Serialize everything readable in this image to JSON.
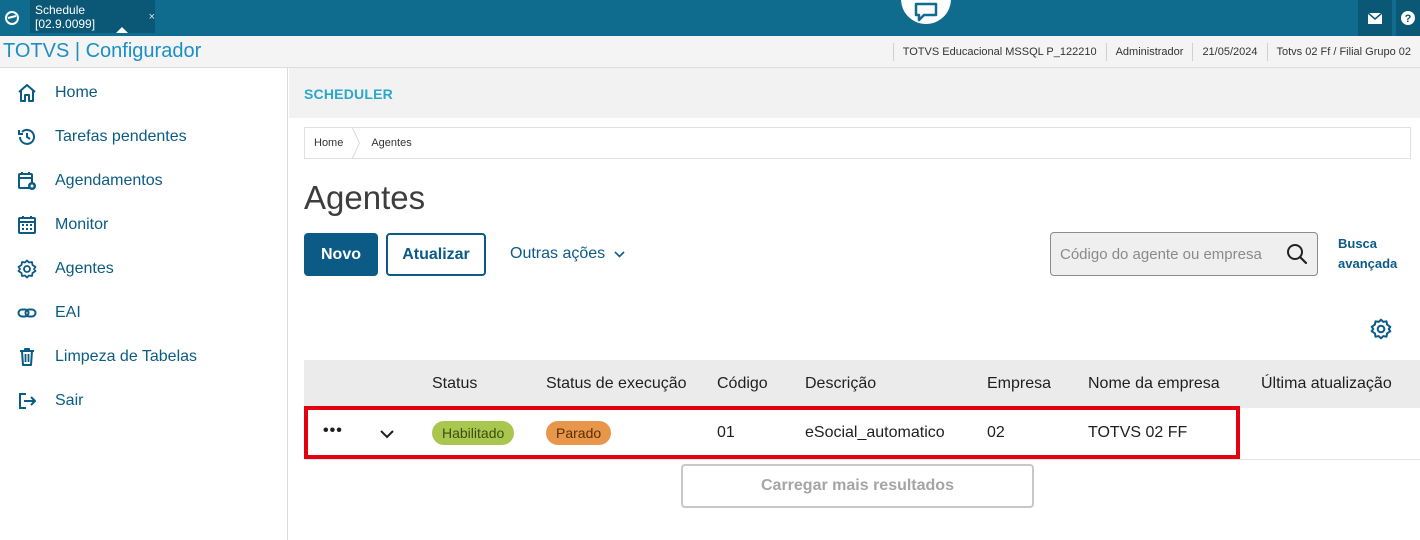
{
  "topbar": {
    "tab_title": "Schedule [02.9.0099]",
    "tab_close": "×",
    "colors": {
      "bar": "#0f6c8f",
      "tab": "#0a5875"
    }
  },
  "header": {
    "app_title": "TOTVS | Configurador",
    "database": "TOTVS Educacional MSSQL P_122210",
    "user": "Administrador",
    "date": "21/05/2024",
    "company": "Totvs 02 Ff / Filial Grupo 02"
  },
  "sidebar": {
    "items": [
      {
        "label": "Home",
        "icon": "home-icon"
      },
      {
        "label": "Tarefas pendentes",
        "icon": "history-icon"
      },
      {
        "label": "Agendamentos",
        "icon": "calendar-gear-icon"
      },
      {
        "label": "Monitor",
        "icon": "calendar-icon"
      },
      {
        "label": "Agentes",
        "icon": "gear-icon"
      },
      {
        "label": "EAI",
        "icon": "link-icon"
      },
      {
        "label": "Limpeza de Tabelas",
        "icon": "trash-icon"
      },
      {
        "label": "Sair",
        "icon": "exit-icon"
      }
    ]
  },
  "main": {
    "section_title": "SCHEDULER",
    "breadcrumb": [
      "Home",
      "Agentes"
    ],
    "page_title": "Agentes",
    "actions": {
      "new_label": "Novo",
      "refresh_label": "Atualizar",
      "more_label": "Outras ações"
    },
    "search": {
      "placeholder": "Código do agente ou empresa",
      "value": "",
      "advanced_label": "Busca avançada"
    },
    "table": {
      "columns": [
        "Status",
        "Status de execução",
        "Código",
        "Descrição",
        "Empresa",
        "Nome da empresa",
        "Última atualização"
      ],
      "rows": [
        {
          "actions": "•••",
          "status": "Habilitado",
          "exec_status": "Parado",
          "code": "01",
          "description": "eSocial_automatico",
          "company": "02",
          "company_name": "TOTVS 02 FF",
          "last_update": ""
        }
      ]
    },
    "load_more_label": "Carregar mais resultados"
  },
  "colors": {
    "accent": "#0c5a86",
    "status_enabled_bg": "#a9c64f",
    "status_enabled_text": "#3b4d12",
    "status_stopped_bg": "#e8964a",
    "status_stopped_text": "#5b2d05",
    "highlight": "#e4000f"
  }
}
